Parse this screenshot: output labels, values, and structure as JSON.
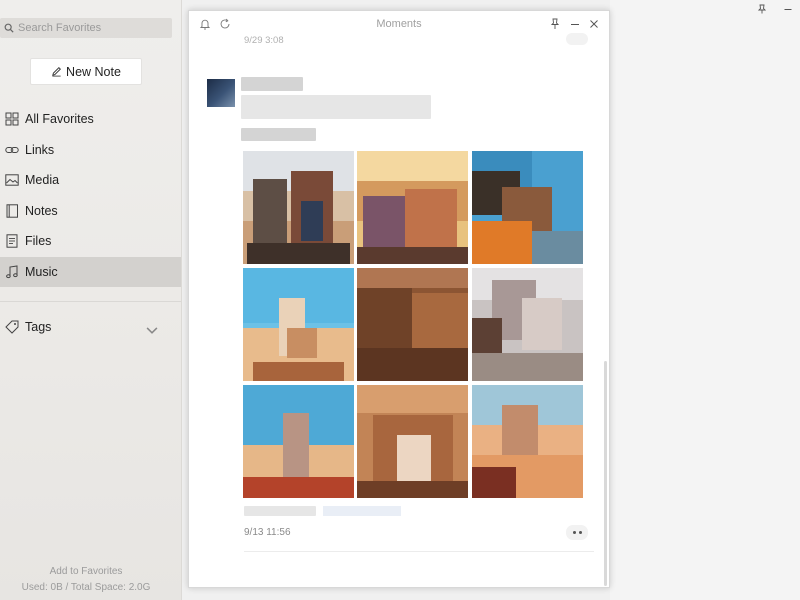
{
  "sidebar": {
    "search_placeholder": "Search Favorites",
    "new_note_label": "New Note",
    "items": [
      {
        "label": "All Favorites",
        "icon": "grid-icon"
      },
      {
        "label": "Links",
        "icon": "link-icon"
      },
      {
        "label": "Media",
        "icon": "image-icon"
      },
      {
        "label": "Notes",
        "icon": "notebook-icon"
      },
      {
        "label": "Files",
        "icon": "file-icon"
      },
      {
        "label": "Music",
        "icon": "music-note-icon",
        "active": true
      }
    ],
    "tags_label": "Tags",
    "footer": {
      "add_to_favorites": "Add to Favorites",
      "space_usage": "Used: 0B / Total Space: 2.0G"
    }
  },
  "moments": {
    "title": "Moments",
    "previous_post_time": "9/29 3:08",
    "post": {
      "time": "9/13 11:56",
      "photos": [
        {
          "name": "photo-1"
        },
        {
          "name": "photo-2"
        },
        {
          "name": "photo-3"
        },
        {
          "name": "photo-4"
        },
        {
          "name": "photo-5"
        },
        {
          "name": "photo-6"
        },
        {
          "name": "photo-7"
        },
        {
          "name": "photo-8"
        },
        {
          "name": "photo-9"
        }
      ]
    }
  },
  "colors": {
    "sidebar_bg": "#ebe9e6",
    "active_item_bg": "#d3d1ce",
    "window_bg": "#ffffff",
    "muted_text": "#9b9b9b"
  }
}
